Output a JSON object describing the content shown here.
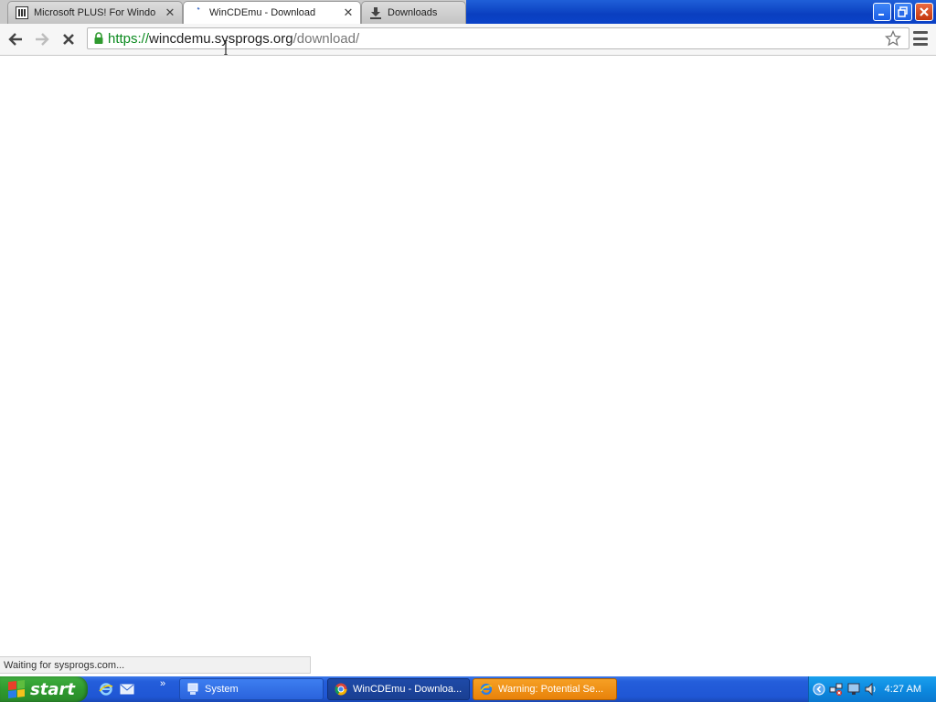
{
  "browser": {
    "tabs": [
      {
        "title": "Microsoft PLUS! For Windo",
        "icon": "columns-icon",
        "active": false
      },
      {
        "title": "WinCDEmu - Download",
        "icon": "loading-icon",
        "active": true
      },
      {
        "title": "Downloads",
        "icon": "download-icon",
        "active": false
      }
    ],
    "url": {
      "scheme": "https://",
      "host": "wincdemu.sysprogs.org",
      "path": "/download/"
    },
    "status_text": "Waiting for sysprogs.com..."
  },
  "taskbar": {
    "start_label": "start",
    "items": [
      {
        "label": "System",
        "icon": "system-icon",
        "state": "normal"
      },
      {
        "label": "WinCDEmu - Downloa...",
        "icon": "chrome-icon",
        "state": "active"
      },
      {
        "label": "Warning: Potential Se...",
        "icon": "ie-icon",
        "state": "flash"
      }
    ],
    "clock": "4:27 AM"
  },
  "colors": {
    "xp_blue": "#245edb",
    "start_green": "#2f9a2f",
    "url_scheme_green": "#0b8a1f",
    "tray_blue": "#0d8ae0",
    "flash_orange": "#e8820a"
  }
}
